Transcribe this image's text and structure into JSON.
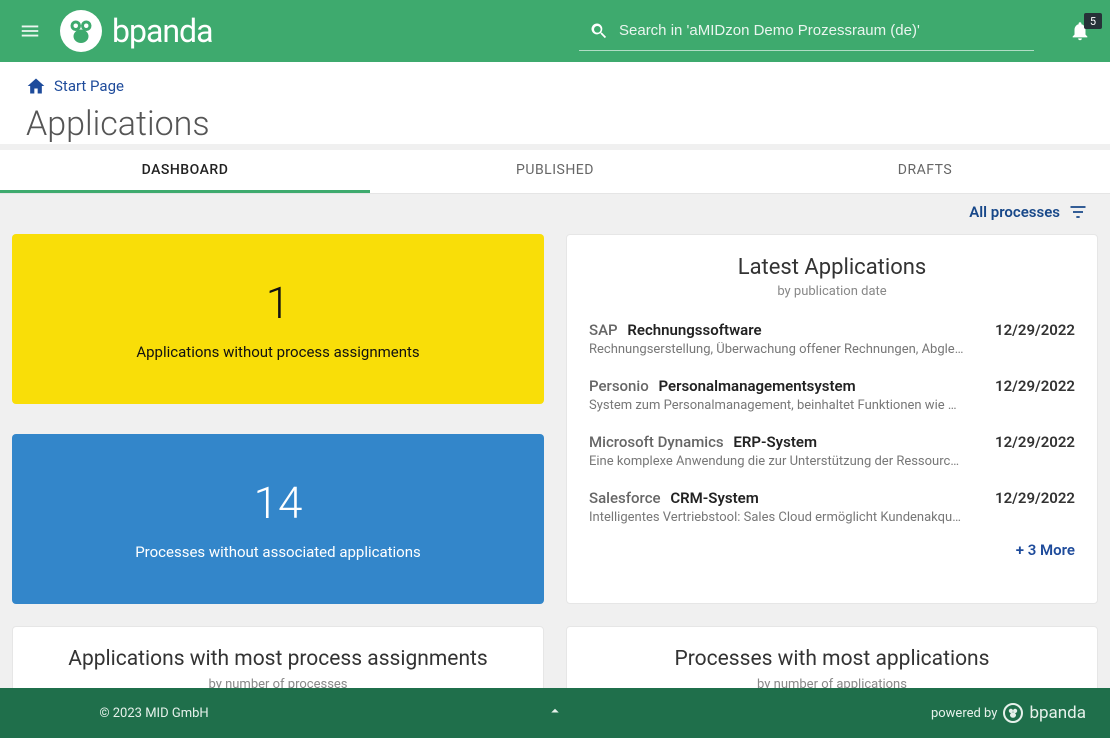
{
  "header": {
    "brand": "bpanda",
    "search_placeholder": "Search in 'aMIDzon Demo Prozessraum (de)'",
    "notification_count": "5"
  },
  "breadcrumb": {
    "label": "Start Page"
  },
  "page": {
    "title": "Applications"
  },
  "tabs": [
    {
      "label": "DASHBOARD",
      "active": true
    },
    {
      "label": "PUBLISHED",
      "active": false
    },
    {
      "label": "DRAFTS",
      "active": false
    }
  ],
  "filter": {
    "label": "All processes"
  },
  "tiles": {
    "no_process": {
      "value": "1",
      "caption": "Applications without process assignments"
    },
    "no_app": {
      "value": "14",
      "caption": "Processes without associated applications"
    }
  },
  "latest": {
    "title": "Latest Applications",
    "subtitle": "by publication date",
    "items": [
      {
        "vendor": "SAP",
        "product": "Rechnungssoftware",
        "desc": "Rechnungserstellung, Überwachung offener Rechnungen, Abgle…",
        "date": "12/29/2022"
      },
      {
        "vendor": "Personio",
        "product": "Personalmanagementsystem",
        "desc": "System zum Personalmanagement, beinhaltet Funktionen wie …",
        "date": "12/29/2022"
      },
      {
        "vendor": "Microsoft Dynamics",
        "product": "ERP-System",
        "desc": "Eine komplexe Anwendung die zur Unterstützung der Ressourc…",
        "date": "12/29/2022"
      },
      {
        "vendor": "Salesforce",
        "product": "CRM-System",
        "desc": "Intelligentes Vertriebstool: Sales Cloud ermöglicht Kundenakqu…",
        "date": "12/29/2022"
      }
    ],
    "more": "+ 3 More"
  },
  "bottom_cards": {
    "apps": {
      "title": "Applications with most process assignments",
      "sub": "by number of processes"
    },
    "procs": {
      "title": "Processes with most applications",
      "sub": "by number of applications"
    }
  },
  "footer": {
    "copyright": "© 2023 MID GmbH",
    "powered_prefix": "powered by",
    "powered_brand": "bpanda"
  }
}
